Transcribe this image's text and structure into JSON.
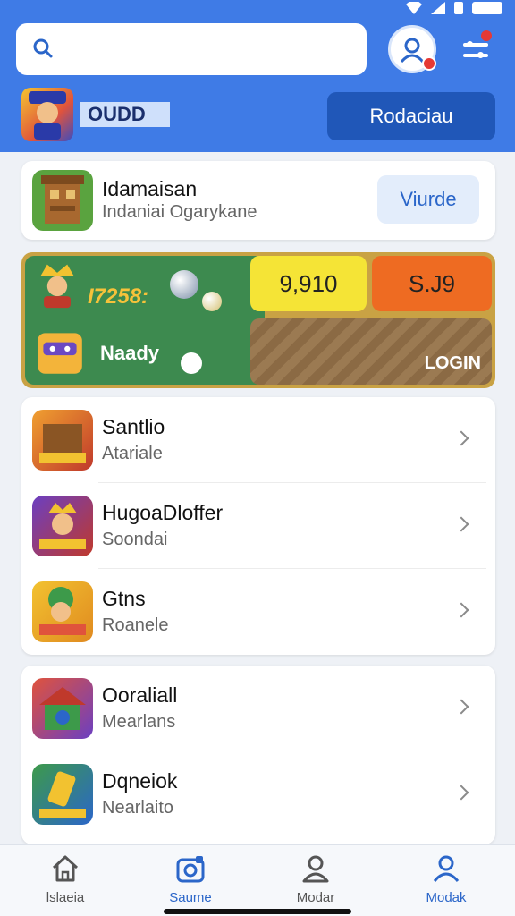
{
  "header": {
    "search": {
      "value": "",
      "placeholder": ""
    },
    "profile_name": "OUDD",
    "reward_button": "Rodaciau"
  },
  "featured": {
    "title": "Idamaisan",
    "subtitle": "Indaniai Ogarykane",
    "button": "Viurde"
  },
  "promo": {
    "score": "I7258:",
    "ready": "Naady",
    "gem1": "9,910",
    "gem2": "S.J9",
    "login": "LOGIN"
  },
  "list1": [
    {
      "title": "Santlio",
      "subtitle": "Atariale"
    },
    {
      "title": "HugoaDloffer",
      "subtitle": "Soondai"
    },
    {
      "title": "Gtns",
      "subtitle": "Roanele"
    }
  ],
  "list2": [
    {
      "title": "Ooraliall",
      "subtitle": "Mearlans"
    },
    {
      "title": "Dqneiok",
      "subtitle": "Nearlaito"
    }
  ],
  "nav": [
    {
      "label": "lslaeia",
      "icon": "home-icon"
    },
    {
      "label": "Saume",
      "icon": "camera-icon"
    },
    {
      "label": "Modar",
      "icon": "user-icon"
    },
    {
      "label": "Modak",
      "icon": "profile-icon"
    }
  ],
  "colors": {
    "header": "#3f7be6",
    "accent": "#2b66c9",
    "badge": "#e53935"
  }
}
